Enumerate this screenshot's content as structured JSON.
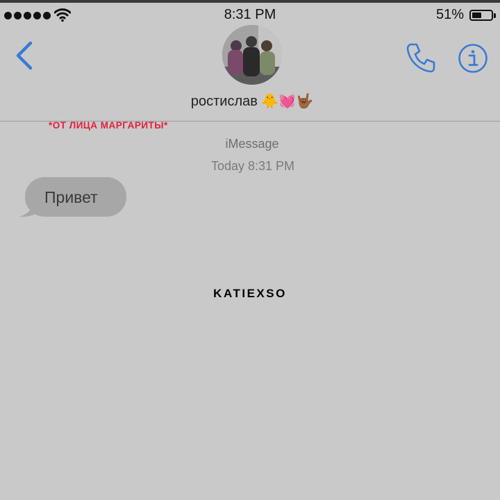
{
  "status_bar": {
    "time": "8:31 PM",
    "battery_percent": "51%",
    "battery_level": 0.51,
    "signal_dots": 5,
    "icons": [
      "signal-dots-icon",
      "wifi-icon",
      "battery-icon"
    ]
  },
  "header": {
    "contact_name": "ростислав 🐥💓🤟🏾",
    "icons": [
      "back-chevron-icon",
      "phone-icon",
      "info-icon"
    ]
  },
  "overlay": {
    "caption": "*ОТ ЛИЦА МАРГАРИТЫ*",
    "watermark": "KATIEXSO"
  },
  "conversation": {
    "service": "iMessage",
    "timestamp": "Today 8:31 PM",
    "messages": [
      {
        "direction": "incoming",
        "text": "Привет"
      }
    ]
  },
  "colors": {
    "accent": "#3a7bd5",
    "background": "#c9c9c9",
    "bubble_incoming": "#a7a7a7",
    "caption": "#e2203a"
  }
}
